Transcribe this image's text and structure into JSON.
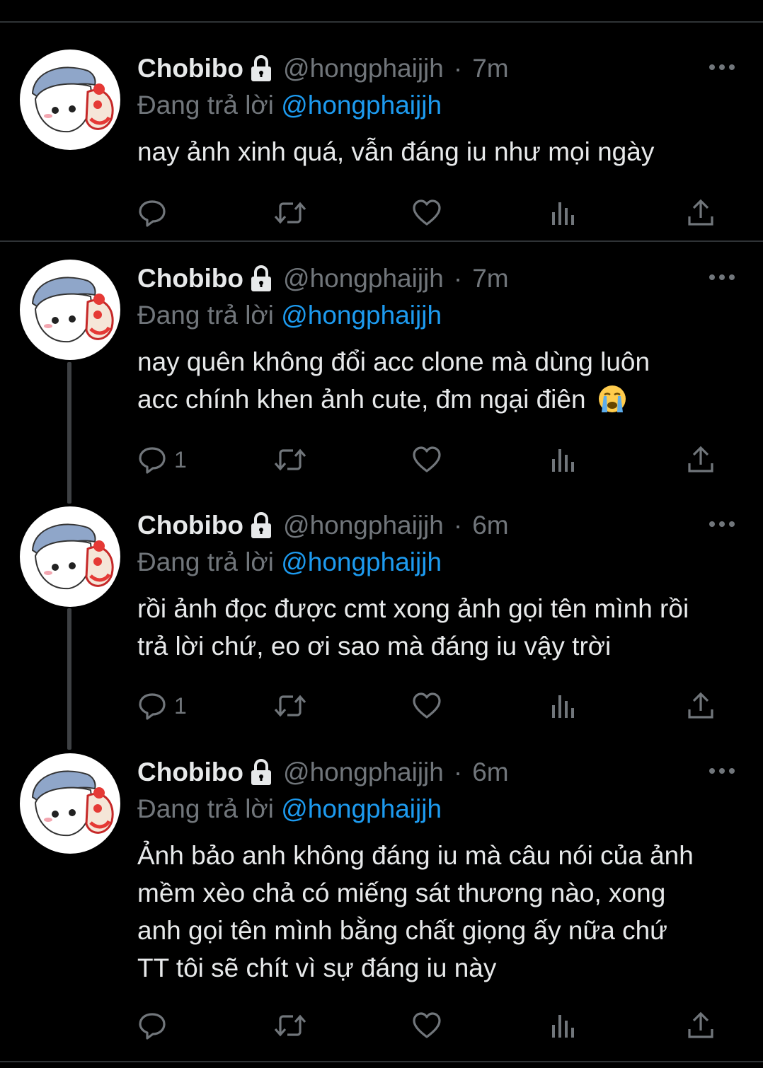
{
  "tweets": [
    {
      "name": "Chobibo",
      "handle": "@hongphaijjh",
      "time": "7m",
      "reply_prefix": "Đang trả lời",
      "reply_to": "@hongphaijjh",
      "text_lines": [
        "nay ảnh xinh quá, vẫn đáng iu như mọi ngày"
      ],
      "reply_count": ""
    },
    {
      "name": "Chobibo",
      "handle": "@hongphaijjh",
      "time": "7m",
      "reply_prefix": "Đang trả lời",
      "reply_to": "@hongphaijjh",
      "text_lines": [
        "nay quên không đổi acc clone mà dùng luôn",
        "acc chính khen ảnh cute, đm ngại điên"
      ],
      "emoji": "loudly-crying-face-icon",
      "reply_count": "1"
    },
    {
      "name": "Chobibo",
      "handle": "@hongphaijjh",
      "time": "6m",
      "reply_prefix": "Đang trả lời",
      "reply_to": "@hongphaijjh",
      "text_lines": [
        "rồi ảnh đọc được cmt xong ảnh gọi tên mình rồi",
        "trả lời chứ, eo ơi sao mà đáng iu vậy trời"
      ],
      "reply_count": "1"
    },
    {
      "name": "Chobibo",
      "handle": "@hongphaijjh",
      "time": "6m",
      "reply_prefix": "Đang trả lời",
      "reply_to": "@hongphaijjh",
      "text_lines": [
        "Ảnh bảo anh không đáng iu mà câu nói của ảnh",
        "mềm xèo chả có miếng sát thương nào, xong",
        "anh gọi tên mình bằng chất giọng ấy nữa chứ",
        "TT tôi sẽ chít vì sự đáng iu này"
      ],
      "reply_count": ""
    }
  ],
  "icons": {
    "lock": "lock-icon",
    "more": "more-icon",
    "reply": "reply-icon",
    "retweet": "retweet-icon",
    "like": "heart-icon",
    "views": "views-icon",
    "share": "share-icon"
  },
  "colors": {
    "background": "#000000",
    "text": "#e7e9ea",
    "muted": "#71767b",
    "mention": "#1d9bf0",
    "divider": "#2f3336"
  }
}
